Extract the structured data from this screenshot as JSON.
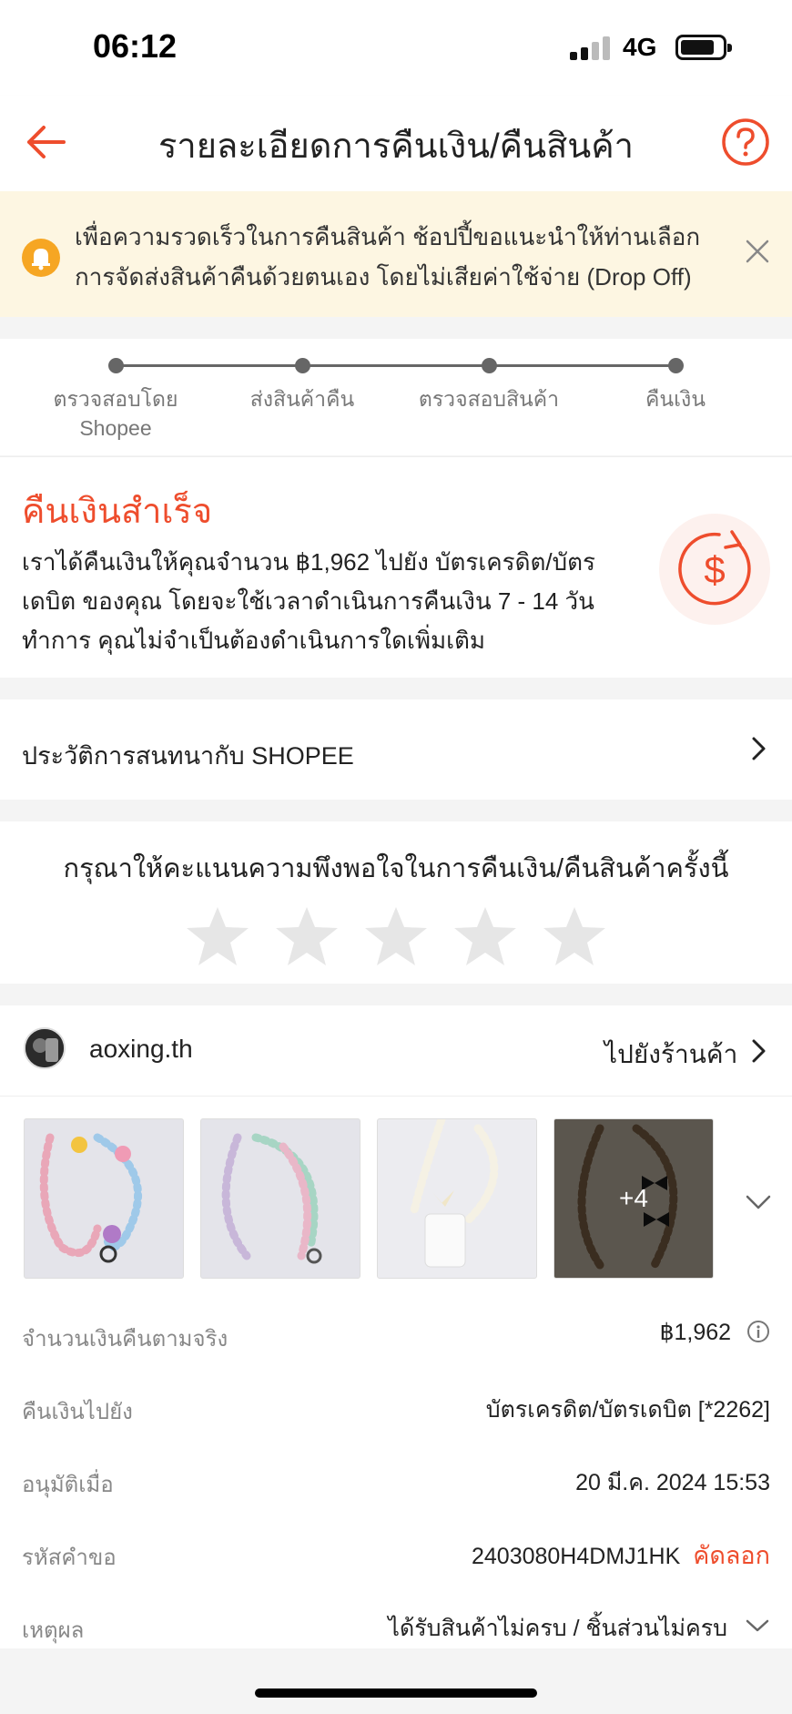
{
  "status_bar": {
    "time": "06:12",
    "network": "4G",
    "battery_level": 0.8
  },
  "header": {
    "title": "รายละเอียดการคืนเงิน/คืนสินค้า"
  },
  "banner": {
    "text": "เพื่อความรวดเร็วในการคืนสินค้า ช้อปปี้ขอแนะนำให้ท่านเลือกการจัดส่งสินค้าคืนด้วยตนเอง โดยไม่เสียค่าใช้จ่าย (Drop Off)"
  },
  "steps": [
    {
      "label": "ตรวจสอบโดย Shopee"
    },
    {
      "label": "ส่งสินค้าคืน"
    },
    {
      "label": "ตรวจสอบสินค้า"
    },
    {
      "label": "คืนเงิน"
    }
  ],
  "refund": {
    "title": "คืนเงินสำเร็จ",
    "description": "เราได้คืนเงินให้คุณจำนวน ฿1,962 ไปยัง บัตรเครดิต/บัตรเดบิต ของคุณ โดยจะใช้เวลาดำเนินการคืนเงิน 7 - 14 วันทำการ คุณไม่จำเป็นต้องดำเนินการใดเพิ่มเติม"
  },
  "chat": {
    "label": "ประวัติการสนทนากับ SHOPEE"
  },
  "rating": {
    "title": "กรุณาให้คะแนนความพึงพอใจในการคืนเงิน/คืนสินค้าครั้งนี้",
    "stars_selected": 0,
    "stars_total": 5
  },
  "shop": {
    "name": "aoxing.th",
    "link_label": "ไปยังร้านค้า"
  },
  "products": {
    "more_count_label": "+4"
  },
  "details": {
    "amount": {
      "label": "จำนวนเงินคืนตามจริง",
      "value": "฿1,962"
    },
    "refund_to": {
      "label": "คืนเงินไปยัง",
      "value": "บัตรเครดิต/บัตรเดบิต [*2262]"
    },
    "approved_at": {
      "label": "อนุมัติเมื่อ",
      "value": "20 มี.ค. 2024 15:53"
    },
    "request_id": {
      "label": "รหัสคำขอ",
      "value": "2403080H4DMJ1HK",
      "copy_label": "คัดลอก"
    },
    "reason": {
      "label": "เหตุผล",
      "value": "ได้รับสินค้าไม่ครบ / ชิ้นส่วนไม่ครบ"
    }
  },
  "colors": {
    "accent": "#ee4d2d",
    "banner_bg": "#fdf6e2",
    "bell": "#f6a623"
  }
}
